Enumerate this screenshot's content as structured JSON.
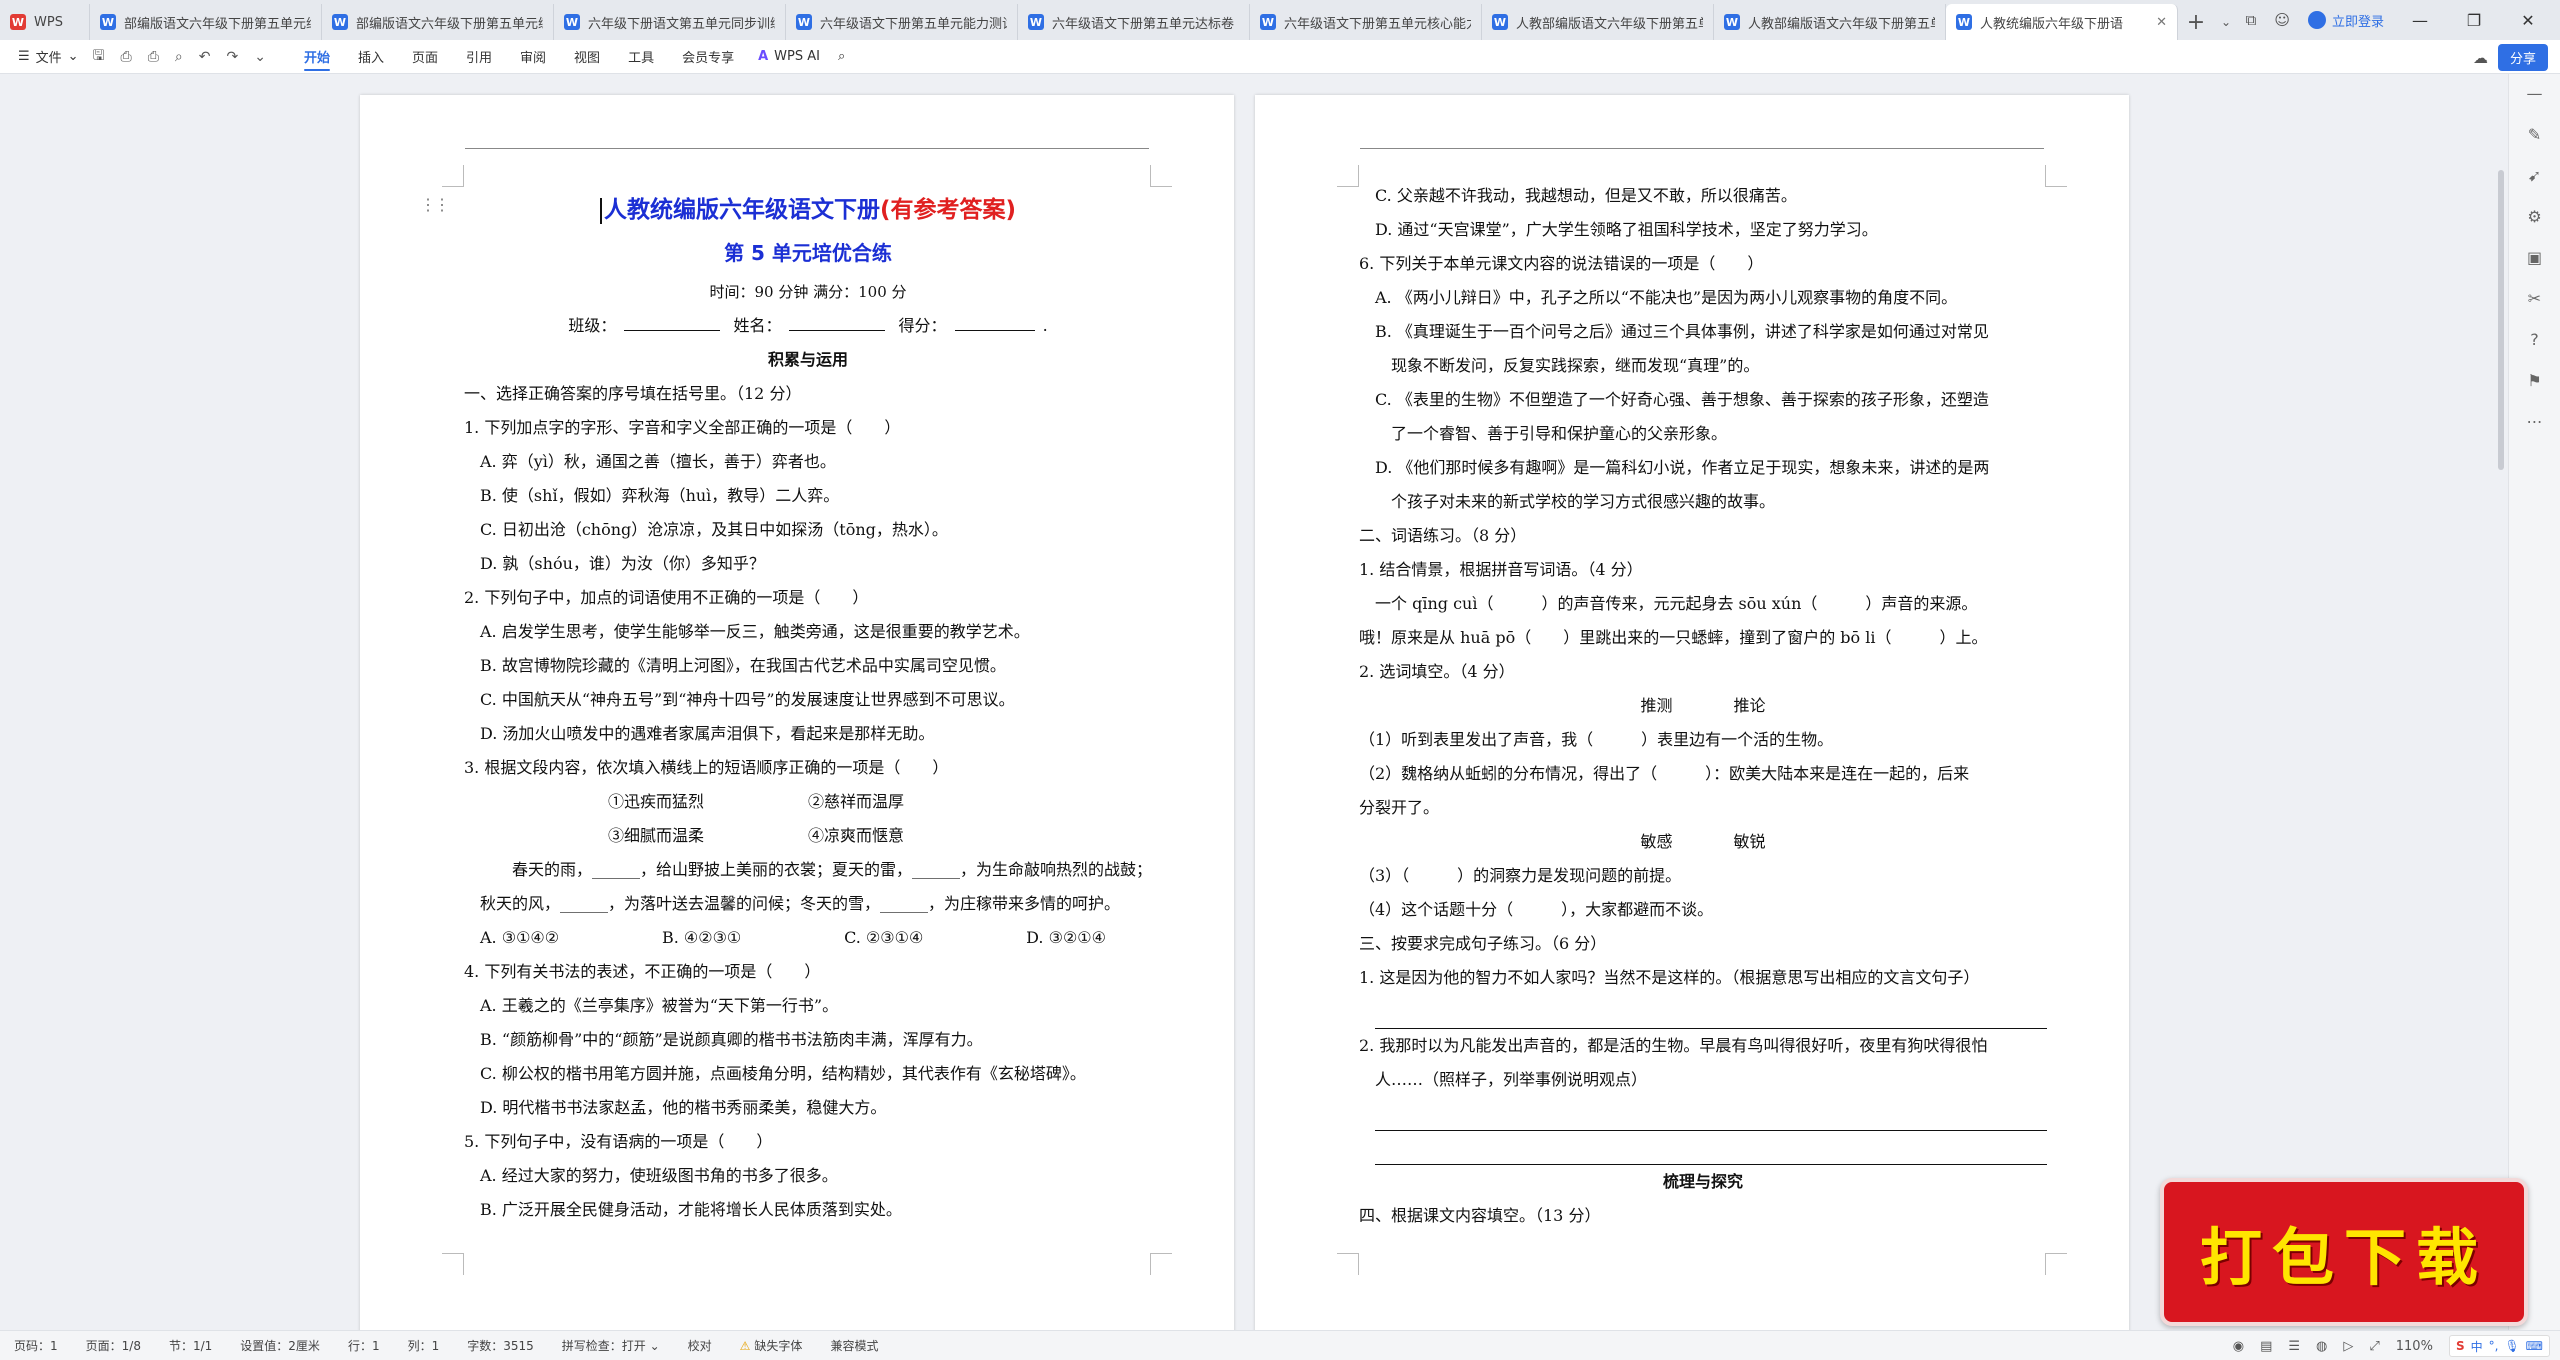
{
  "tabs": [
    {
      "label": "WPS",
      "active": false,
      "type": "wps"
    },
    {
      "label": "部编版语文六年级下册第五单元综合",
      "active": false
    },
    {
      "label": "部编版语文六年级下册第五单元练",
      "active": false
    },
    {
      "label": "六年级下册语文第五单元同步训练卷",
      "active": false
    },
    {
      "label": "六年级语文下册第五单元能力测试卷（有",
      "active": false
    },
    {
      "label": "六年级语文下册第五单元达标卷（有",
      "active": false
    },
    {
      "label": "六年级语文下册第五单元核心能力达",
      "active": false
    },
    {
      "label": "人教部编版语文六年级下册第五单",
      "active": false
    },
    {
      "label": "人教部编版语文六年级下册第五单",
      "active": false
    },
    {
      "label": "人教统编版六年级下册语",
      "active": true
    }
  ],
  "titlebar": {
    "add_tab": "+",
    "tab_list": "⌄",
    "login": "立即登录",
    "minimize": "—",
    "restore": "❐",
    "close": "✕"
  },
  "ribbon": {
    "file_menu": "文件",
    "tabs": [
      "开始",
      "插入",
      "页面",
      "引用",
      "审阅",
      "视图",
      "工具",
      "会员专享"
    ],
    "active_tab": "开始",
    "wps_ai": "WPS AI",
    "share": "分享"
  },
  "page_left": {
    "title_main": "人教统编版六年级语文下册",
    "title_note": "(有参考答案)",
    "subtitle": "第 5 单元培优合练",
    "meta": "时间：90 分钟 满分：100 分",
    "info": {
      "class": "班级：",
      "name": "姓名：",
      "score": "得分：",
      "end": "."
    },
    "section1": "积累与运用",
    "lines": [
      "一、选择正确答案的序号填在括号里。（12 分）",
      "1. 下列加点字的字形、字音和字义全部正确的一项是（　　）",
      "A. 弈（yì）秋，通国之善（擅长，善于）弈者也。",
      "B. 使（shǐ，假如）弈秋海（huì，教导）二人弈。",
      "C. 日初出沧（chōng）沧凉凉，及其日中如探汤（tōng，热水）。",
      "D. 孰（shóu，谁）为汝（你）多知乎？",
      "2. 下列句子中，加点的词语使用不正确的一项是（　　）",
      "A. 启发学生思考，使学生能够举一反三，触类旁通，这是很重要的教学艺术。",
      "B. 故宫博物院珍藏的《清明上河图》，在我国古代艺术品中实属司空见惯。",
      "C. 中国航天从“神舟五号”到“神舟十四号”的发展速度让世界感到不可思议。",
      "D. 汤加火山喷发中的遇难者家属声泪俱下，看起来是那样无助。",
      "3. 根据文段内容，依次填入横线上的短语顺序正确的一项是（　　）"
    ],
    "choices_grid": [
      "①迅疾而猛烈",
      "②慈祥而温厚",
      "③细腻而温柔",
      "④凉爽而惬意"
    ],
    "passage": "春天的雨，______，给山野披上美丽的衣裳；夏天的雷，______，为生命敲响热烈的战鼓；秋天的风，______，为落叶送去温馨的问候；冬天的雪，______，为庄稼带来多情的呵护。",
    "q3_options": [
      "A. ③①④②",
      "B. ④②③①",
      "C. ②③①④",
      "D. ③②①④"
    ],
    "lines2": [
      "4. 下列有关书法的表述，不正确的一项是（　　）",
      "A. 王羲之的《兰亭集序》被誉为“天下第一行书”。",
      "B. “颜筋柳骨”中的“颜筋”是说颜真卿的楷书书法筋肉丰满，浑厚有力。",
      "C. 柳公权的楷书用笔方圆并施，点画棱角分明，结构精妙，其代表作有《玄秘塔碑》。",
      "D. 明代楷书书法家赵孟，他的楷书秀丽柔美，稳健大方。",
      "5. 下列句子中，没有语病的一项是（　　）",
      "A. 经过大家的努力，使班级图书角的书多了很多。",
      "B. 广泛开展全民健身活动，才能将增长人民体质落到实处。"
    ]
  },
  "page_right": {
    "lines": [
      "C. 父亲越不许我动，我越想动，但是又不敢，所以很痛苦。",
      "D. 通过“天宫课堂”，广大学生领略了祖国科学技术，坚定了努力学习。",
      "6. 下列关于本单元课文内容的说法错误的一项是（　　）",
      "A. 《两小儿辩日》中，孔子之所以“不能决也”是因为两小儿观察事物的角度不同。",
      "B. 《真理诞生于一百个问号之后》通过三个具体事例，讲述了科学家是如何通过对常见",
      "现象不断发问，反复实践探索，继而发现“真理”的。",
      "C. 《表里的生物》不但塑造了一个好奇心强、善于想象、善于探索的孩子形象，还塑造",
      "了一个睿智、善于引导和保护童心的父亲形象。",
      "D. 《他们那时候多有趣啊》是一篇科幻小说，作者立足于现实，想象未来，讲述的是两",
      "个孩子对未来的新式学校的学习方式很感兴趣的故事。",
      "二、词语练习。（8 分）",
      "1. 结合情景，根据拼音写词语。（4 分）",
      "一个 qīng cuì（　　　）的声音传来，元元起身去 sōu xún（　　　）声音的来源。",
      "哦！原来是从 huā pō（　　）里跳出来的一只蟋蟀，撞到了窗户的 bō li（　　　）上。",
      "2. 选词填空。（4 分）"
    ],
    "pair1": [
      "推测",
      "推论"
    ],
    "lines_b": [
      "（1）听到表里发出了声音，我（　　　）表里边有一个活的生物。",
      "（2）魏格纳从蚯蚓的分布情况，得出了（　　　）：欧美大陆本来是连在一起的，后来",
      "分裂开了。"
    ],
    "pair2": [
      "敏感",
      "敏锐"
    ],
    "lines_c": [
      "（3）（　　　）的洞察力是发现问题的前提。",
      "（4）这个话题十分（　　　），大家都避而不谈。",
      "三、按要求完成句子练习。（6 分）",
      "1. 这是因为他的智力不如人家吗？当然不是这样的。（根据意思写出相应的文言文句子）"
    ],
    "lines_d": [
      "2. 我那时以为凡能发出声音的，都是活的生物。早晨有鸟叫得很好听，夜里有狗吠得很怕",
      "人……（照样子，列举事例说明观点）"
    ],
    "section2": "梳理与探究",
    "last_line": "四、根据课文内容填空。（13 分）"
  },
  "banner": {
    "text": "打包下载"
  },
  "statusbar": {
    "items": [
      "页码：1",
      "页面：1/8",
      "节：1/1",
      "设置值：2厘米",
      "行：1",
      "列：1",
      "字数：3515",
      "拼写检查：打开 ⌄",
      "校对"
    ],
    "warning": "缺失字体",
    "mode": "兼容模式",
    "zoom": "110%",
    "ime": "中"
  },
  "colors": {
    "accent": "#2f6fe4",
    "title_blue": "#1b2fd4",
    "title_red": "#e02020",
    "banner_red": "#d8161f",
    "banner_text": "#ffe500"
  }
}
